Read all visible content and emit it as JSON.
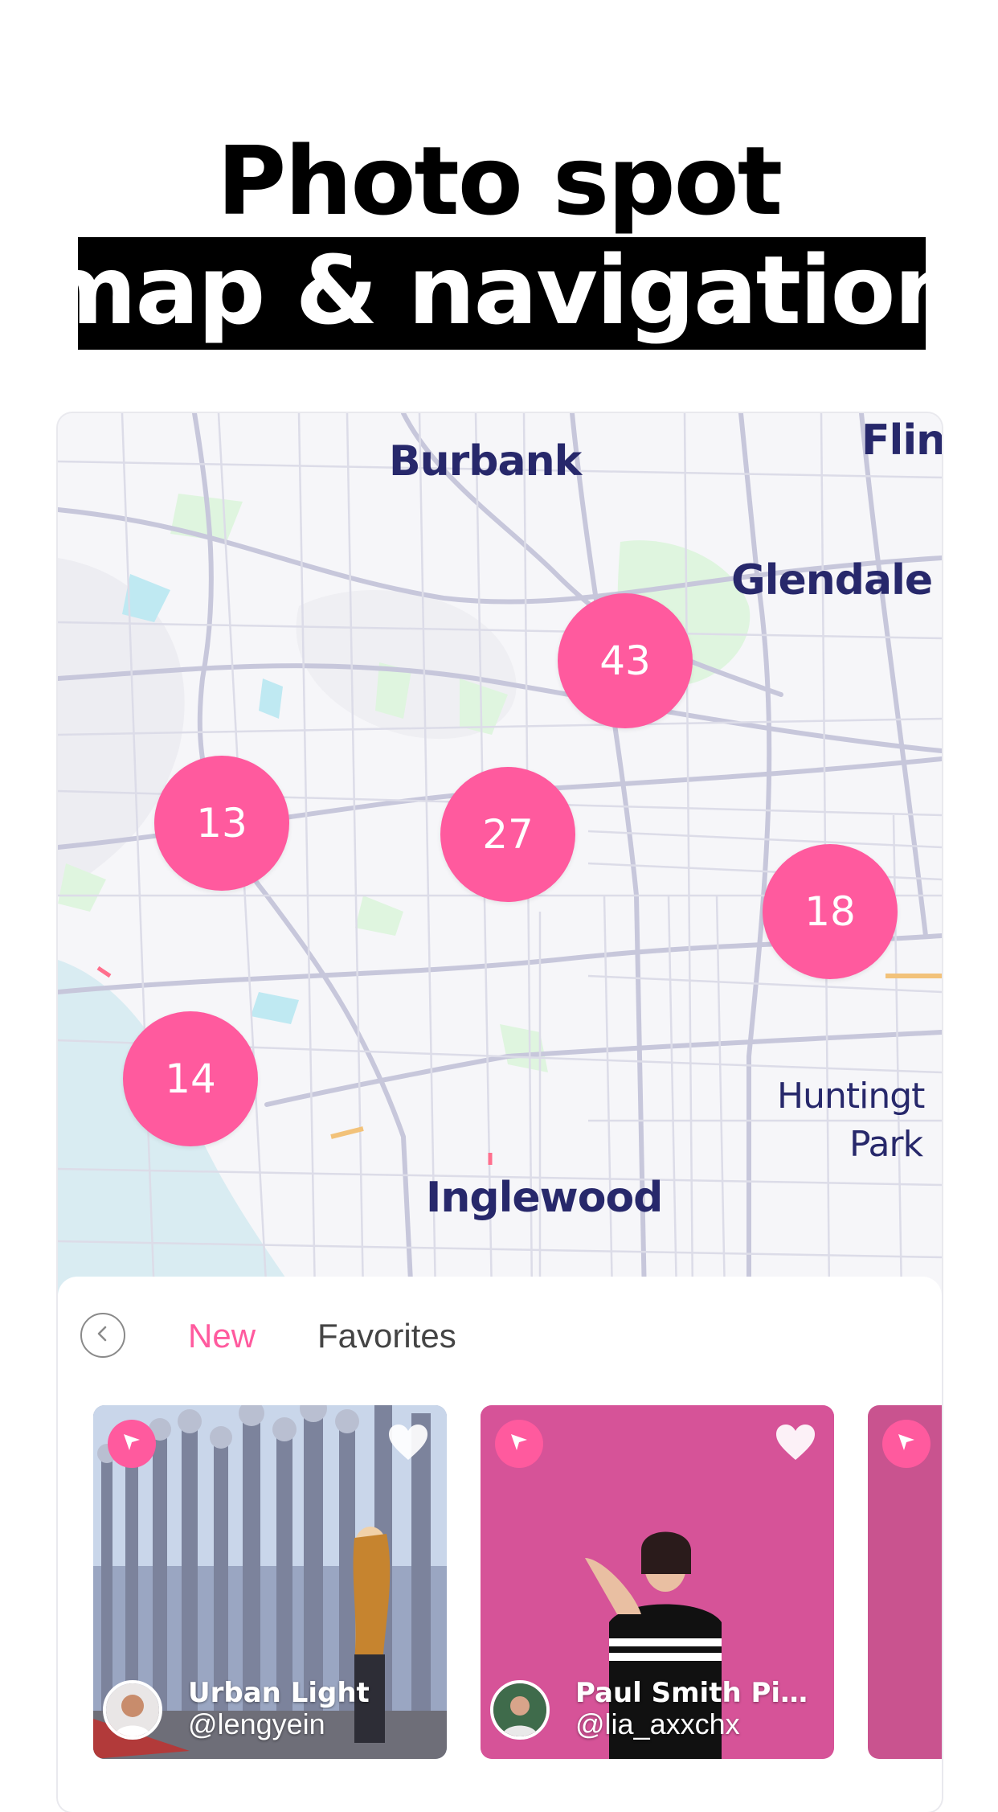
{
  "headline": {
    "line1": "Photo spot",
    "line2": "map & navigation"
  },
  "map": {
    "labels": {
      "burbank": "Burbank",
      "flint": "Flint",
      "glendale": "Glendale",
      "huntington": "Huntingt",
      "park": "Park",
      "inglewood": "Inglewood"
    },
    "clusters": [
      {
        "count": "43"
      },
      {
        "count": "13"
      },
      {
        "count": "27"
      },
      {
        "count": "18"
      },
      {
        "count": "14"
      }
    ],
    "cluster_color": "#ff5a9e",
    "water_color": "#d9ecf2",
    "park_color": "#c6f0c6",
    "road_color": "#c7c7db"
  },
  "sheet": {
    "back_icon": "chevron-left-icon",
    "tabs": [
      {
        "label": "New",
        "active": true
      },
      {
        "label": "Favorites",
        "active": false
      }
    ]
  },
  "cards": [
    {
      "title": "Urban Light",
      "handle": "@lengyein",
      "nav_icon": "navigation-arrow-icon",
      "fav_icon": "heart-icon"
    },
    {
      "title": "Paul Smith Pin…",
      "handle": "@lia_axxchx",
      "nav_icon": "navigation-arrow-icon",
      "fav_icon": "heart-icon"
    },
    {
      "title": "",
      "handle": "",
      "nav_icon": "navigation-arrow-icon",
      "fav_icon": ""
    }
  ],
  "colors": {
    "accent": "#ff5a9e",
    "label": "#27286b"
  }
}
